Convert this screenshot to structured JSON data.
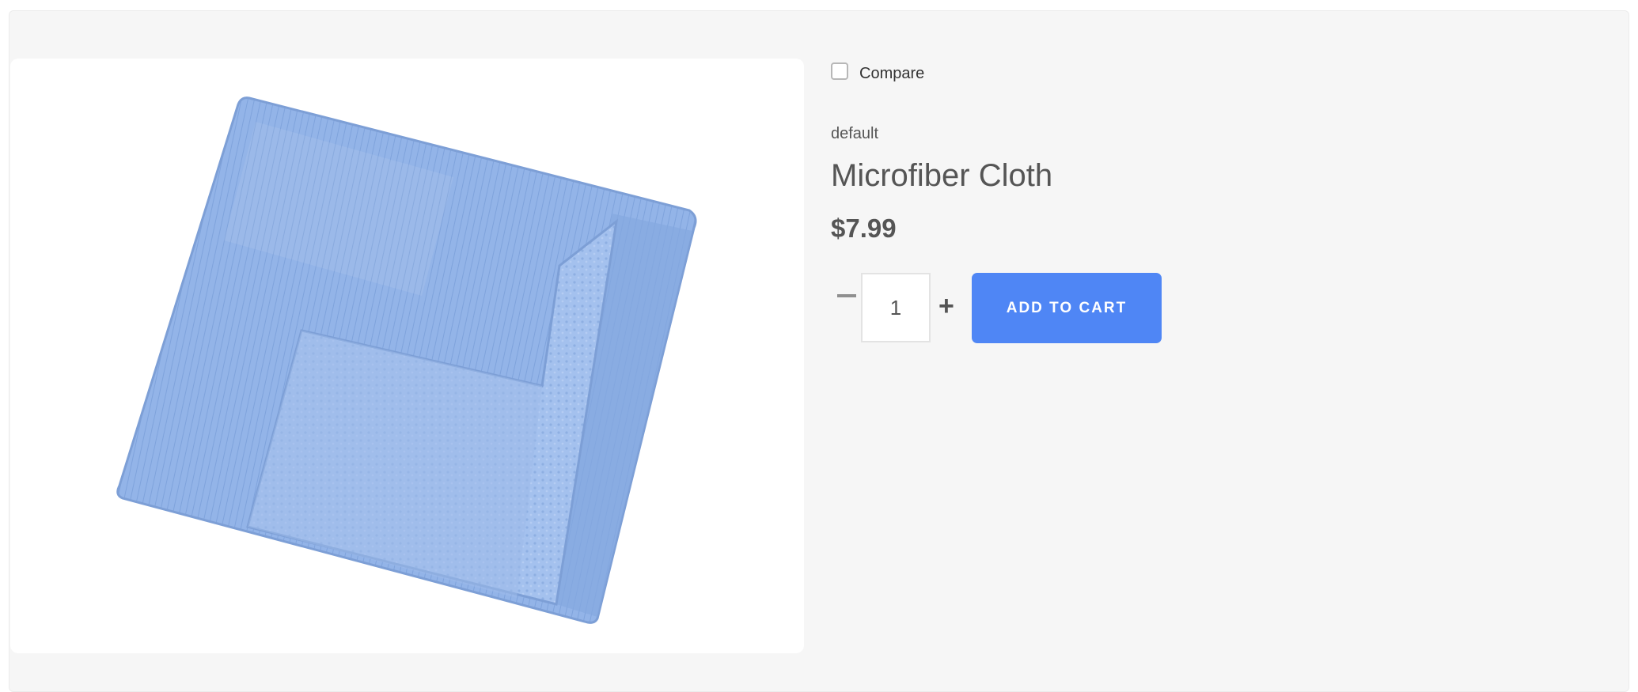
{
  "product": {
    "image_alt": "Blue folded microfiber cloth",
    "compare_label": "Compare",
    "vendor": "default",
    "title": "Microfiber Cloth",
    "price": "$7.99",
    "quantity": "1",
    "minus_symbol": "–",
    "plus_symbol": "+",
    "add_to_cart_label": "ADD TO CART"
  },
  "colors": {
    "accent": "#4f86f5",
    "panel_background": "#f6f6f6",
    "cloth_blue": "#8fb2e8"
  },
  "icons": [
    "checkbox-icon",
    "minus-icon",
    "plus-icon",
    "product-image"
  ]
}
